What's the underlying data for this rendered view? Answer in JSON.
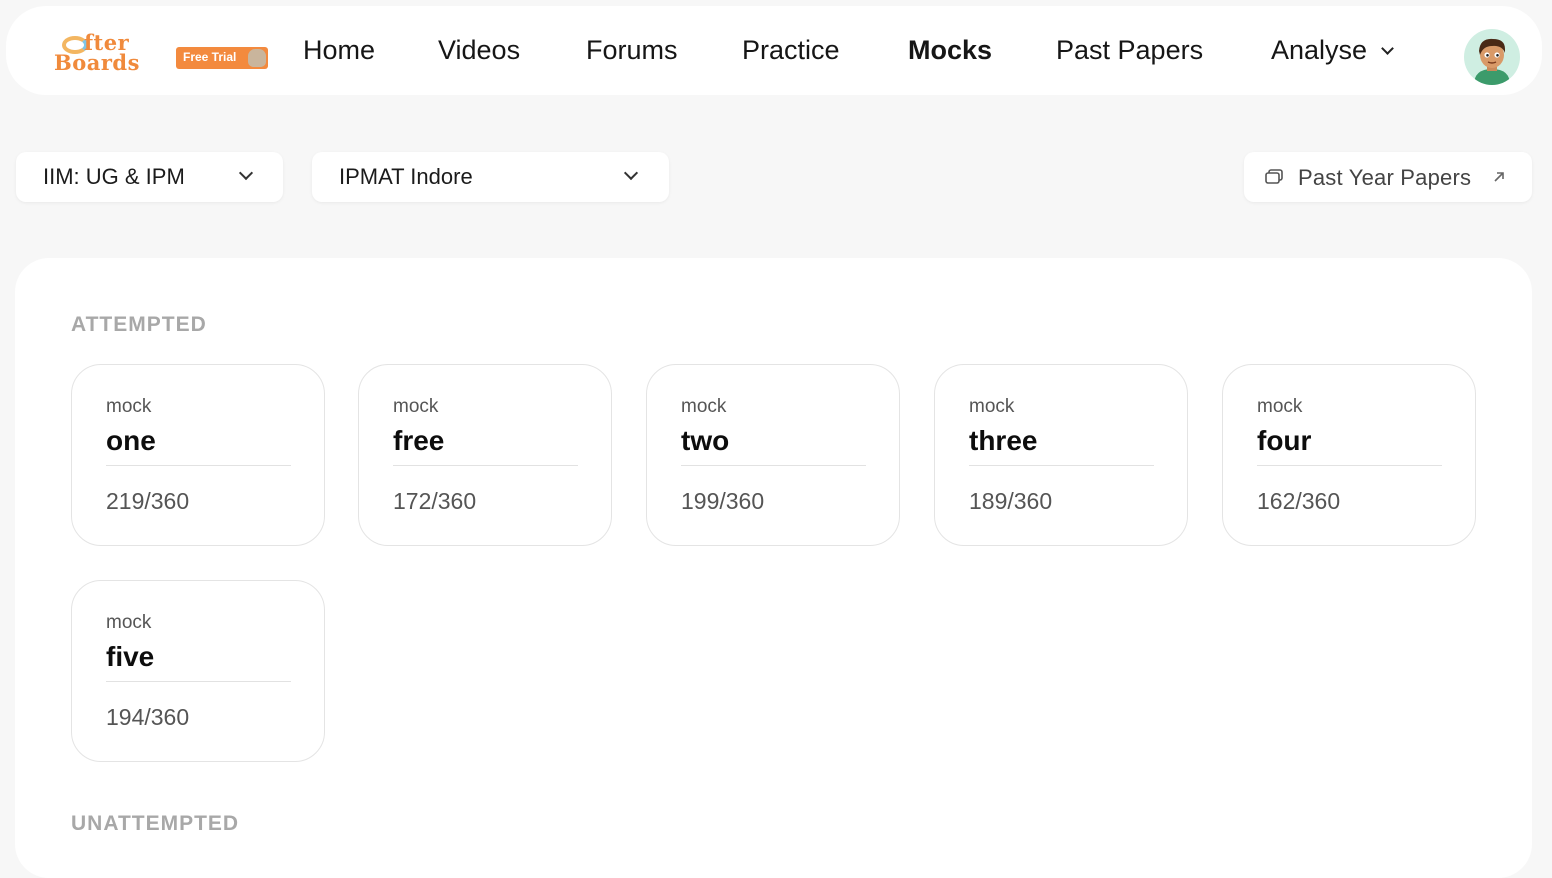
{
  "nav": {
    "brand": {
      "line1": "fter",
      "line2": "Boards",
      "badge": "Free Trial"
    },
    "links": [
      "Home",
      "Videos",
      "Forums",
      "Practice",
      "Mocks",
      "Past Papers",
      "Analyse"
    ],
    "active": "Mocks",
    "accent": "#f38a3e"
  },
  "filters": {
    "exam_group": "IIM: UG & IPM",
    "exam": "IPMAT Indore",
    "past_year_button": "Past Year Papers"
  },
  "sections": {
    "attempted_title": "ATTEMPTED",
    "unattempted_title": "UNATTEMPTED"
  },
  "mocks": [
    {
      "kicker": "mock",
      "name": "one",
      "score": "219/360"
    },
    {
      "kicker": "mock",
      "name": "free",
      "score": "172/360"
    },
    {
      "kicker": "mock",
      "name": "two",
      "score": "199/360"
    },
    {
      "kicker": "mock",
      "name": "three",
      "score": "189/360"
    },
    {
      "kicker": "mock",
      "name": "four",
      "score": "162/360"
    },
    {
      "kicker": "mock",
      "name": "five",
      "score": "194/360"
    }
  ]
}
